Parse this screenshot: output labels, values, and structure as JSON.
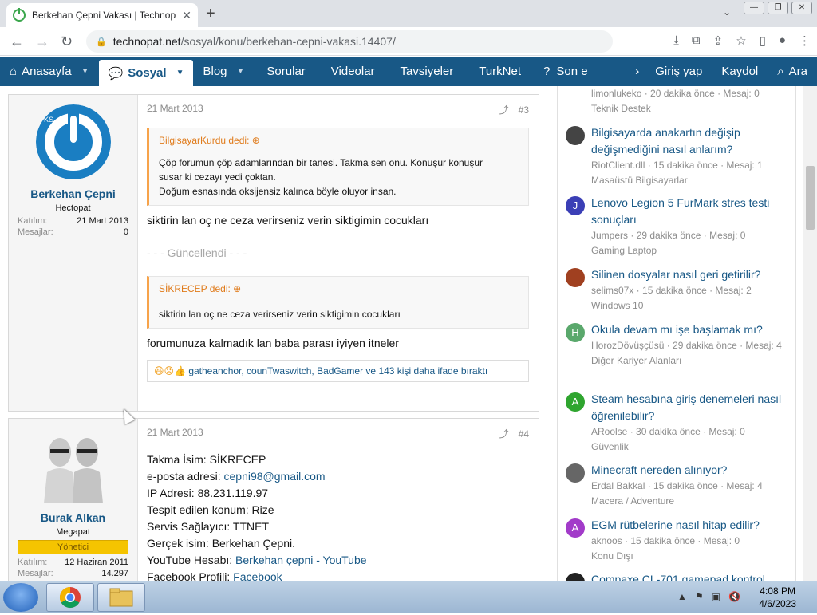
{
  "browser": {
    "tab_title": "Berkehan Çepni Vakası | Technop",
    "url_host": "technopat.net",
    "url_path": "/sosyal/konu/berkehan-cepni-vakasi.14407/"
  },
  "sitenav": {
    "items": [
      "Anasayfa",
      "Sosyal",
      "Blog",
      "Sorular",
      "Videolar",
      "Tavsiyeler",
      "TurkNet",
      "Son e"
    ],
    "right": [
      "Giriş yap",
      "Kaydol",
      "Ara"
    ]
  },
  "post1": {
    "user_name": "Berkehan Çepni",
    "user_title": "Hectopat",
    "stat1_label": "Katılım:",
    "stat1_value": "21 Mart 2013",
    "stat2_label": "Mesajlar:",
    "stat2_value": "0",
    "date": "21 Mart 2013",
    "num": "#3",
    "quote1_head": "BilgisayarKurdu dedi:",
    "quote1_line1": "Çöp forumun çöp adamlarından bir tanesi. Takma sen onu. Konuşur konuşur",
    "quote1_line2": "susar ki cezayı yedi çoktan.",
    "quote1_line3": "Doğum esnasında oksijensiz kalınca böyle oluyor insan.",
    "text1": "siktirin lan oç ne ceza verirseniz verin siktigimin cocukları",
    "updated": "- - - Güncellendi - - -",
    "quote2_head": "SİKRECEP dedi:",
    "quote2_body": "siktirin lan oç ne ceza verirseniz verin siktigimin cocukları",
    "text2": "forumunuza kalmadık lan baba parası iyiyen itneler",
    "reactions": "gatheanchor, counTwaswitch, BadGamer ve 143 kişi daha ifade bıraktı"
  },
  "post2": {
    "user_name": "Burak Alkan",
    "user_title": "Megapat",
    "badge": "Yönetici",
    "stat1_label": "Katılım:",
    "stat1_value": "12 Haziran 2011",
    "stat2_label": "Mesajlar:",
    "stat2_value": "14.297",
    "date": "21 Mart 2013",
    "num": "#4",
    "lines": [
      {
        "label": "Takma İsim: ",
        "value": "SİKRECEP"
      },
      {
        "label": "e-posta adresi: ",
        "value": "cepni98@gmail.com"
      },
      {
        "label": "IP Adresi: ",
        "value": "88.231.119.97"
      },
      {
        "label": "Tespit edilen konum: ",
        "value": "Rize"
      },
      {
        "label": "Servis Sağlayıcı: ",
        "value": "TTNET"
      },
      {
        "label": "Gerçek isim: ",
        "value": "Berkehan Çepni."
      },
      {
        "label": "YouTube Hesabı: ",
        "value": "Berkehan çepni - YouTube"
      },
      {
        "label": "Facebook Profili: ",
        "value": "Facebook"
      }
    ]
  },
  "sidebar": {
    "items": [
      {
        "title": "",
        "meta": "limonlukeko · 20 dakika önce · Mesaj: 0",
        "cat": "Teknik Destek",
        "avatar": "",
        "color": ""
      },
      {
        "title": "Bilgisayarda anakartın değişip değişmediğini nasıl anlarım?",
        "meta": "RiotClient.dll · 15 dakika önce · Mesaj: 1",
        "cat": "Masaüstü Bilgisayarlar",
        "avatar": "",
        "color": "#444444"
      },
      {
        "title": "Lenovo Legion 5 FurMark stres testi sonuçları",
        "meta": "Jumpers · 29 dakika önce · Mesaj: 0",
        "cat": "Gaming Laptop",
        "avatar": "J",
        "color": "#3b3fb6"
      },
      {
        "title": "Silinen dosyalar nasıl geri getirilir?",
        "meta": "selims07x · 15 dakika önce · Mesaj: 2",
        "cat": "Windows 10",
        "avatar": "",
        "color": "#a04020"
      },
      {
        "title": "Okula devam mı işe başlamak mı?",
        "meta": "HorozDövüşçüsü · 29 dakika önce · Mesaj: 4",
        "cat": "Diğer Kariyer Alanları",
        "avatar": "H",
        "color": "#5aa86c"
      },
      {
        "title": "Steam hesabına giriş denemeleri nasıl öğrenilebilir?",
        "meta": "ARoolse · 30 dakika önce · Mesaj: 0",
        "cat": "Güvenlik",
        "avatar": "A",
        "color": "#2fa52f"
      },
      {
        "title": "Minecraft nereden alınıyor?",
        "meta": "Erdal Bakkal · 15 dakika önce · Mesaj: 4",
        "cat": "Macera / Adventure",
        "avatar": "",
        "color": "#666666"
      },
      {
        "title": "EGM rütbelerine nasıl hitap edilir?",
        "meta": "aknoos · 15 dakika önce · Mesaj: 0",
        "cat": "Konu Dışı",
        "avatar": "A",
        "color": "#a23bc9"
      },
      {
        "title": "Compaxe CL-701 gamepad kontrol",
        "meta": "",
        "cat": "",
        "avatar": "",
        "color": "#222222"
      }
    ]
  },
  "taskbar": {
    "time": "4:08 PM",
    "date": "4/6/2023"
  }
}
